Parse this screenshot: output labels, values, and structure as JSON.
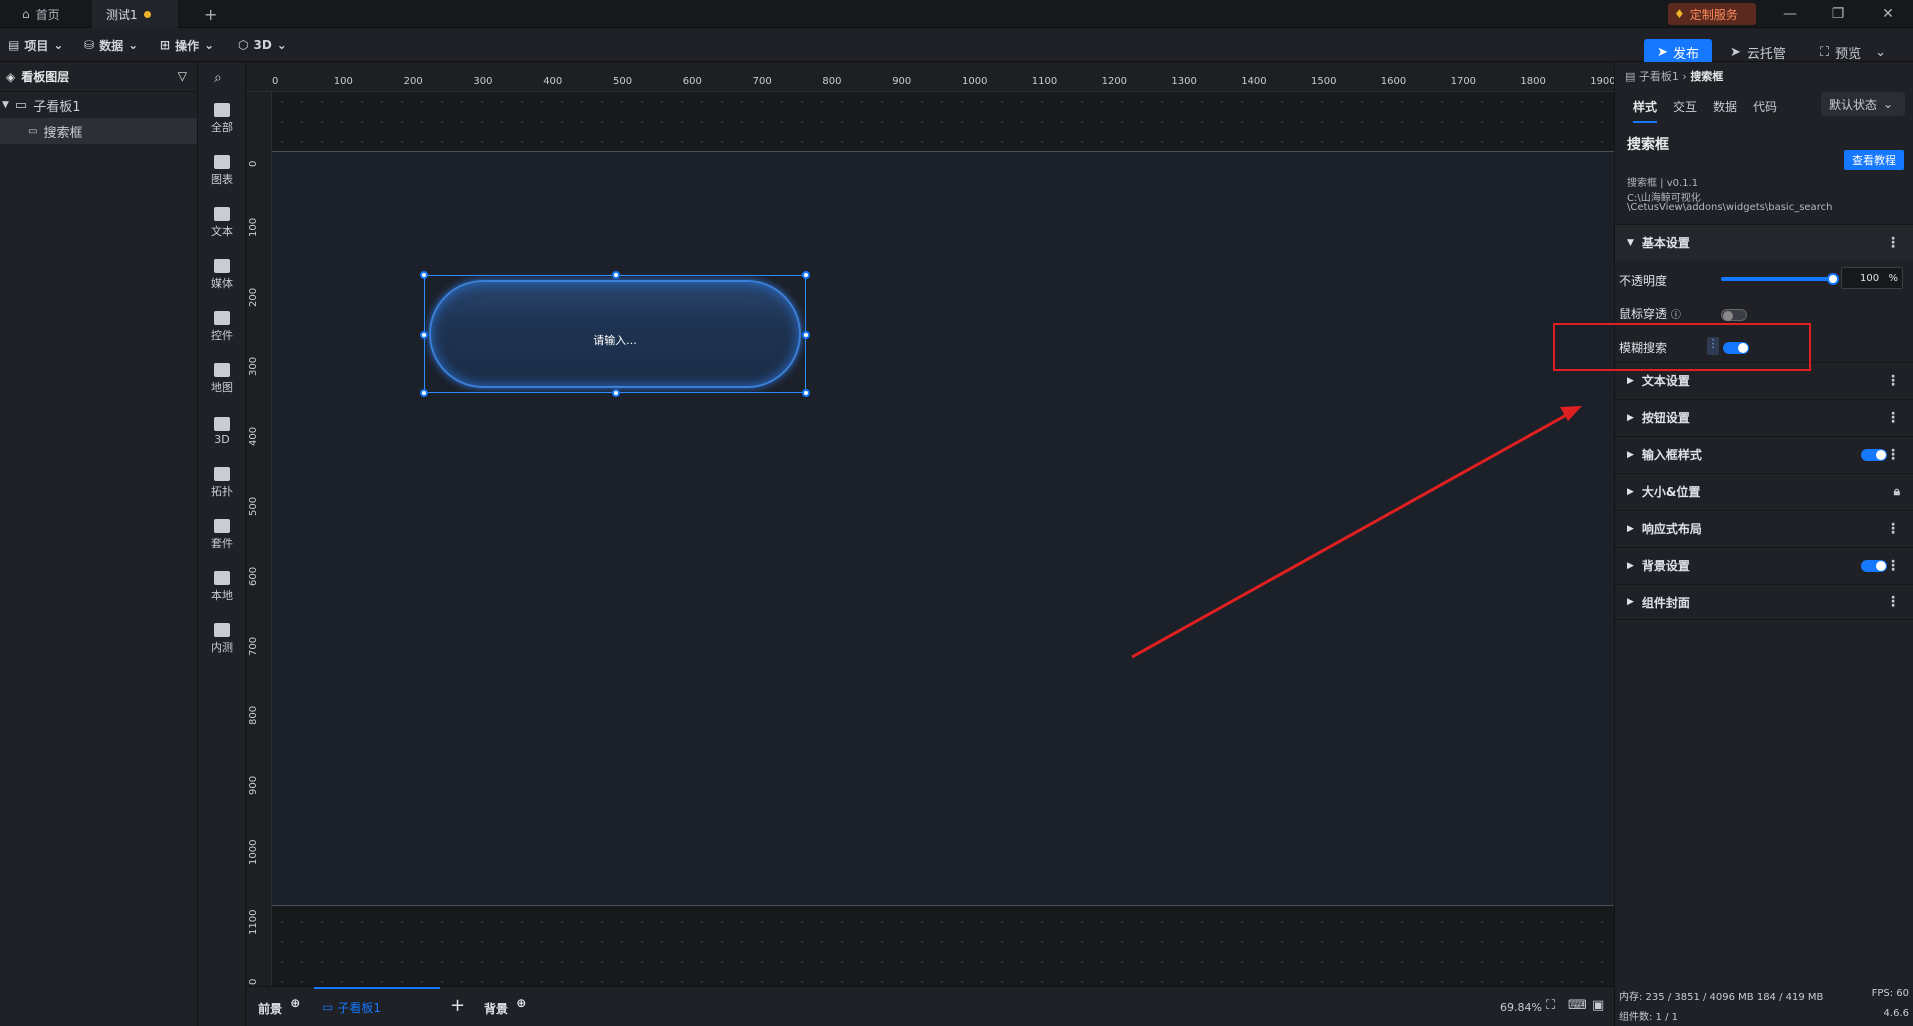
{
  "tabs": [
    {
      "label": "首页"
    },
    {
      "label": "测试1"
    }
  ],
  "window": {
    "service_label": "定制服务"
  },
  "toolbar": {
    "menus": [
      "项目",
      "数据",
      "操作",
      "3D"
    ],
    "publish": "发布",
    "cloud": "云托管",
    "preview": "预览"
  },
  "layers": {
    "title": "看板图层",
    "items": [
      {
        "label": "子看板1"
      },
      {
        "label": "搜索框"
      }
    ]
  },
  "palette": [
    "全部",
    "图表",
    "文本",
    "媒体",
    "控件",
    "地图",
    "3D",
    "拓扑",
    "套件",
    "本地",
    "内测"
  ],
  "ruler": {
    "top": [
      "0",
      "100",
      "200",
      "300",
      "400",
      "500",
      "600",
      "700",
      "800",
      "900",
      "1000",
      "1100",
      "1200",
      "1300",
      "1400",
      "1500",
      "1600",
      "1700",
      "1800",
      "1900"
    ],
    "left": [
      "0",
      "100",
      "200",
      "300",
      "400",
      "500",
      "600",
      "700",
      "800",
      "900",
      "1000",
      "1100",
      "0"
    ]
  },
  "widget": {
    "placeholder": "请输入..."
  },
  "bottom": {
    "front": "前景",
    "board": "子看板1",
    "back": "背景",
    "zoom": "69.84%"
  },
  "props": {
    "breadcrumb_parent": "子看板1",
    "breadcrumb_current": "搜索框",
    "tabs": [
      "样式",
      "交互",
      "数据",
      "代码"
    ],
    "state": "默认状态",
    "component_title": "搜索框",
    "tutorial": "查看教程",
    "version": "搜索框 | v0.1.1",
    "path_line1": "C:\\山海鲸可视化",
    "path_line2": "\\CetusView\\addons\\widgets\\basic_search",
    "basic_section": "基本设置",
    "opacity_label": "不透明度",
    "opacity_value": "100",
    "opacity_unit": "%",
    "mouse_label": "鼠标穿透",
    "fuzzy_label": "模糊搜索",
    "sections": [
      "文本设置",
      "按钮设置",
      "输入框样式",
      "大小&位置",
      "响应式布局",
      "背景设置",
      "组件封面"
    ]
  },
  "status": {
    "memory": "内存: 235 / 3851 / 4096 MB 184 / 419 MB",
    "fps": "FPS: 60",
    "count": "组件数: 1 / 1",
    "version": "4.6.6"
  },
  "colors": {
    "accent": "#1677ff",
    "annotation": "#e02020"
  }
}
